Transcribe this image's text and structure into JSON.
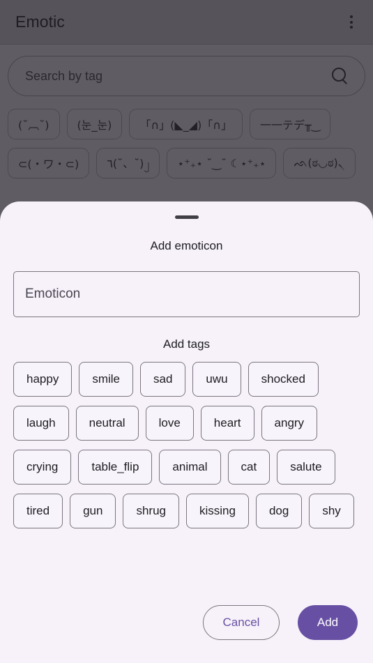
{
  "app": {
    "title": "Emotic",
    "overflow_menu_icon": "more-vert-icon"
  },
  "search": {
    "placeholder": "Search by tag",
    "icon": "search-icon",
    "value": ""
  },
  "emoticons": [
    {
      "text": "(˘︹˘)"
    },
    {
      "text": "(눈_눈)"
    },
    {
      "text": "「∩」(◣_◢)「∩」"
    },
    {
      "text": "一一テデ╥‿"
    },
    {
      "text": "⊂(・ワ・⊂)"
    },
    {
      "text": "٦(˘、˘)၂"
    },
    {
      "text": "⋆⁺₊⋆ ˘‿˘ ☾⋆⁺₊⋆"
    },
    {
      "text": "ᨒ(ಠ◡ಠ)৲"
    }
  ],
  "sheet": {
    "drag_handle_icon": "drag-handle-icon",
    "title": "Add emoticon",
    "emoticon_field": {
      "placeholder": "Emoticon",
      "value": ""
    },
    "tags_title": "Add tags",
    "tags": [
      "happy",
      "smile",
      "sad",
      "uwu",
      "shocked",
      "laugh",
      "neutral",
      "love",
      "heart",
      "angry",
      "crying",
      "table_flip",
      "animal",
      "cat",
      "salute",
      "tired",
      "gun",
      "shrug",
      "kissing",
      "dog",
      "shy"
    ],
    "cancel_label": "Cancel",
    "add_label": "Add"
  },
  "colors": {
    "primary": "#6750A4",
    "sheet_background": "#F7F2FA",
    "app_bar": "#69666E",
    "outline": "#79747E"
  }
}
